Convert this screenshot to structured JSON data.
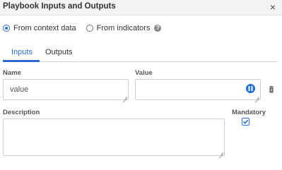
{
  "dialog": {
    "title": "Playbook Inputs and Outputs",
    "close_icon": "close-icon"
  },
  "source": {
    "options": [
      {
        "label": "From context data",
        "checked": true
      },
      {
        "label": "From indicators",
        "checked": false
      }
    ],
    "help_icon": "question-circle-icon"
  },
  "tabs": [
    {
      "label": "Inputs",
      "active": true
    },
    {
      "label": "Outputs",
      "active": false
    }
  ],
  "form": {
    "name_label": "Name",
    "name_value": "value",
    "value_label": "Value",
    "value_value": "",
    "description_label": "Description",
    "description_value": "",
    "mandatory_label": "Mandatory",
    "mandatory_checked": true
  },
  "colors": {
    "accent": "#2a6ad1",
    "context_icon": "#1f6fd6"
  }
}
